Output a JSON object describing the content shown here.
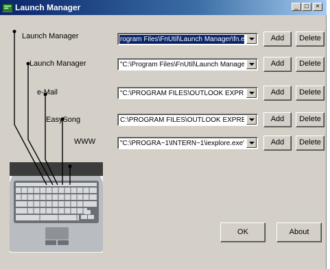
{
  "window": {
    "title": "Launch Manager",
    "minimize_label": "_",
    "maximize_label": "□",
    "close_label": "×"
  },
  "rows": [
    {
      "label": "Launch Manager",
      "value": "rogram Files\\FnUtil\\Launch Manager\\fn.exe\"",
      "selected": true,
      "add_label": "Add",
      "delete_label": "Delete"
    },
    {
      "label": "Launch Manager",
      "value": "\"C:\\Program Files\\FnUtil\\Launch Manager\\f",
      "selected": false,
      "add_label": "Add",
      "delete_label": "Delete"
    },
    {
      "label": "e-Mail",
      "value": "\"C:\\PROGRAM FILES\\OUTLOOK EXPRES",
      "selected": false,
      "add_label": "Add",
      "delete_label": "Delete"
    },
    {
      "label": "EasySong",
      "value": "C:\\PROGRAM FILES\\OUTLOOK EXPRESS",
      "selected": false,
      "add_label": "Add",
      "delete_label": "Delete"
    },
    {
      "label": "WWW",
      "value": "\"C:\\PROGRA~1\\INTERN~1\\iexplore.exe\"",
      "selected": false,
      "add_label": "Add",
      "delete_label": "Delete"
    }
  ],
  "footer": {
    "ok_label": "OK",
    "about_label": "About"
  },
  "icons": {
    "app": "launch-manager-icon",
    "dropdown": "chevron-down-icon",
    "laptop": "laptop-keyboard-image"
  },
  "colors": {
    "titlebar_start": "#0a246a",
    "titlebar_end": "#a6caf0",
    "face": "#d4d0c8",
    "selection": "#0a246a"
  }
}
